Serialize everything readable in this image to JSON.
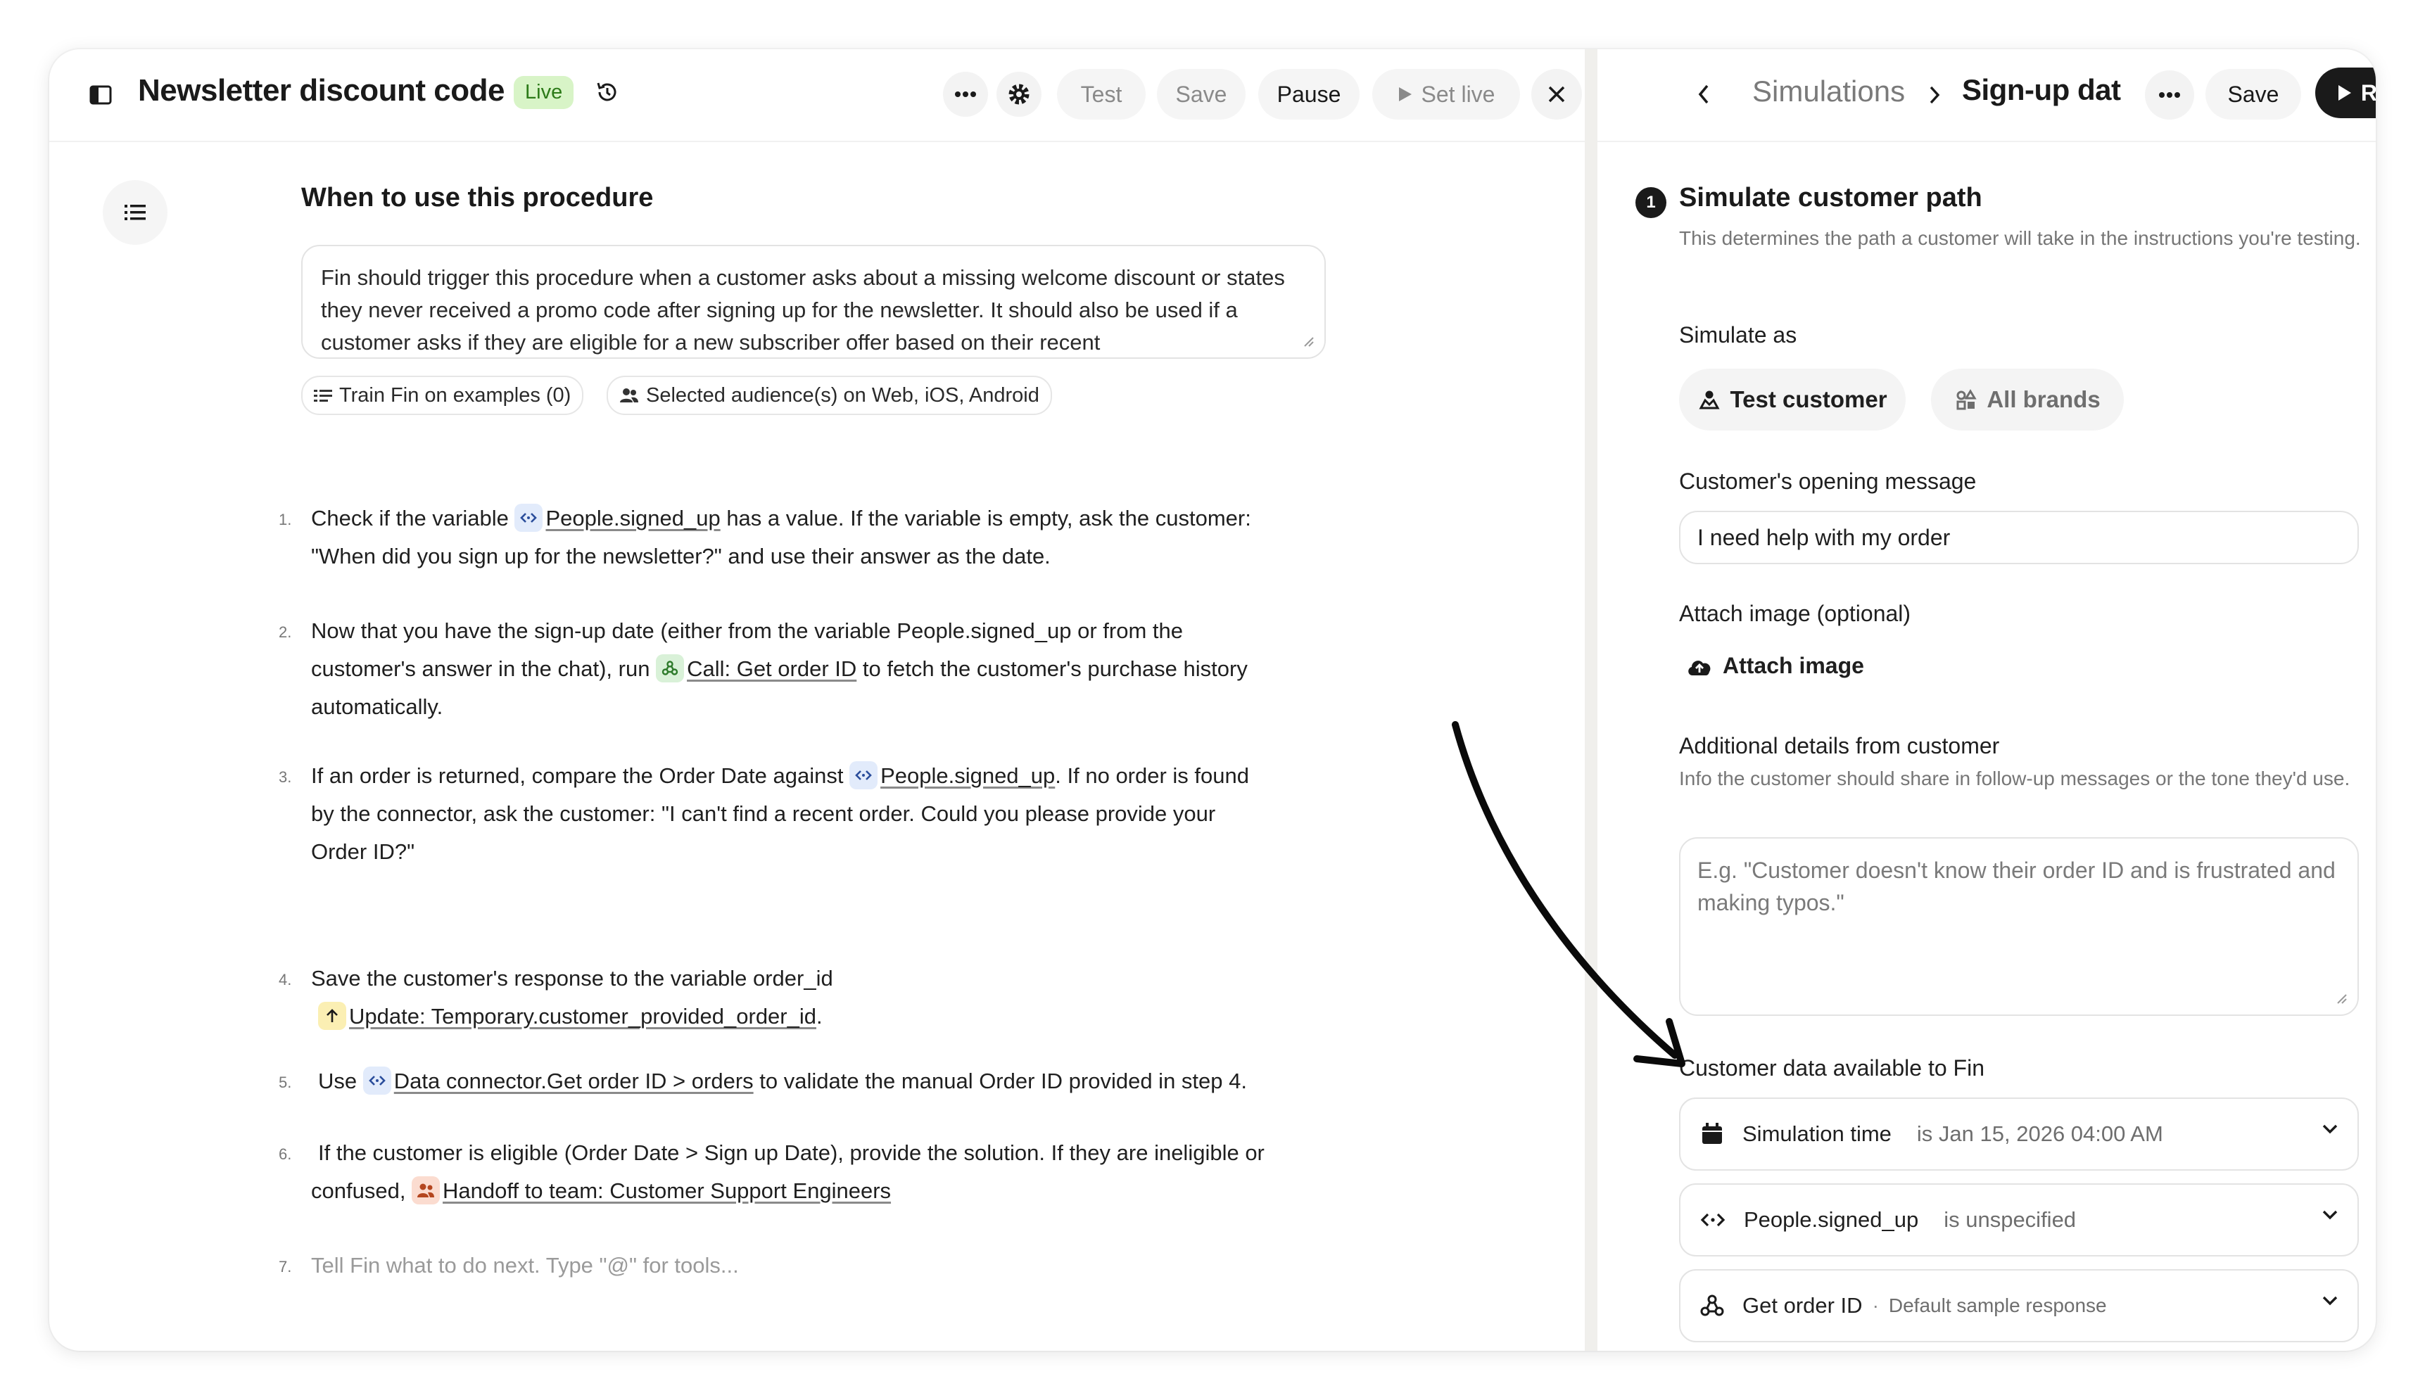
{
  "editor": {
    "title": "Newsletter discount code",
    "status_badge": "Live",
    "buttons": {
      "test": "Test",
      "save": "Save",
      "pause": "Pause",
      "set_live": "Set live"
    },
    "section_heading": "When to use this procedure",
    "trigger_text": "Fin should trigger this procedure when a customer asks about a missing welcome discount or states they never received a promo code after signing up for the newsletter. It should also be used if a customer asks if they are eligible for a new subscriber offer based on their recent",
    "chips": {
      "train": "Train Fin on examples (0)",
      "audience": "Selected audience(s) on Web, iOS, Android"
    },
    "steps": [
      {
        "num": "1.",
        "a": "Check if the variable ",
        "token": "People.signed_up",
        "b": " has a value. If the variable is empty, ask the customer:",
        "line2": "\"When did you sign up for the newsletter?\" and use their answer as the date."
      },
      {
        "num": "2.",
        "line1": "Now that you have the sign-up date (either from the variable People.signed_up or from the",
        "a": "customer's answer in the chat), run ",
        "token": "Call: Get order ID",
        "b": " to fetch the customer's purchase history",
        "line3": "automatically."
      },
      {
        "num": "3.",
        "a": "If an order is returned, compare the Order Date against ",
        "token": "People.signed_up",
        "b": ". If no order is found",
        "line2": "by the connector, ask the customer: \"I can't find a recent order. Could you please provide your",
        "line3": "Order ID?\""
      },
      {
        "num": "4.",
        "line1": "Save the customer's response to the variable order_id",
        "token": "Update: Temporary.customer_provided_order_id",
        "b": "."
      },
      {
        "num": "5.",
        "a": "Use ",
        "token": "Data connector.Get order ID > orders",
        "b": " to validate the manual Order ID provided in step 4."
      },
      {
        "num": "6.",
        "line1": "If the customer is eligible (Order Date > Sign up Date), provide the solution. If they are ineligible or",
        "a": "confused, ",
        "token": "Handoff to team: Customer Support Engineers"
      },
      {
        "num": "7.",
        "placeholder": "Tell Fin what to do next. Type \"@\" for tools..."
      }
    ]
  },
  "simulator": {
    "breadcrumb_parent": "Simulations",
    "breadcrumb_current": "Sign-up dat",
    "save_label": "Save",
    "run_label": "Run",
    "step_badge": "1",
    "heading": "Simulate customer path",
    "description": "This determines the path a customer will take in the instructions you're testing.",
    "simulate_as_label": "Simulate as",
    "test_customer_label": "Test customer",
    "all_brands_label": "All brands",
    "opening_message_label": "Customer's opening message",
    "opening_message_value": "I need help with my order",
    "attach_label": "Attach image (optional)",
    "attach_button": "Attach image",
    "details_label": "Additional details from customer",
    "details_hint": "Info the customer should share in follow-up messages or the tone they'd use.",
    "details_placeholder": "E.g. \"Customer doesn't know their order ID and is frustrated and making typos.\"",
    "data_label": "Customer data available to Fin",
    "data_rows": [
      {
        "name": "Simulation time",
        "value": "is Jan 15, 2026 04:00 AM"
      },
      {
        "name": "People.signed_up",
        "value": "is unspecified"
      },
      {
        "name": "Get order ID",
        "separator": "·",
        "value": "Default sample response"
      }
    ]
  }
}
